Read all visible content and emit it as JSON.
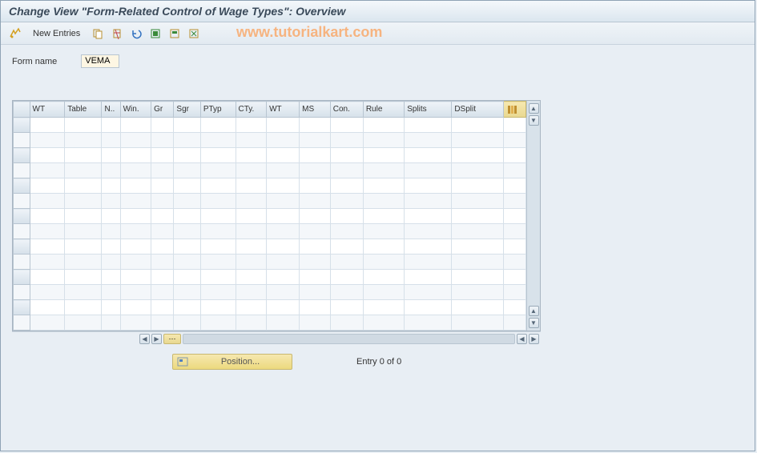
{
  "header": {
    "title": "Change View \"Form-Related Control of Wage Types\": Overview"
  },
  "toolbar": {
    "new_entries": "New Entries"
  },
  "watermark": "www.tutorialkart.com",
  "form": {
    "label": "Form name",
    "value": "VEMA"
  },
  "grid": {
    "columns": [
      "WT",
      "Table",
      "N..",
      "Win.",
      "Gr",
      "Sgr",
      "PTyp",
      "CTy.",
      "WT",
      "MS",
      "Con.",
      "Rule",
      "Splits",
      "DSplit"
    ],
    "row_count": 14,
    "col_count": 15
  },
  "footer": {
    "position_label": "Position...",
    "entry_text": "Entry 0 of 0"
  }
}
